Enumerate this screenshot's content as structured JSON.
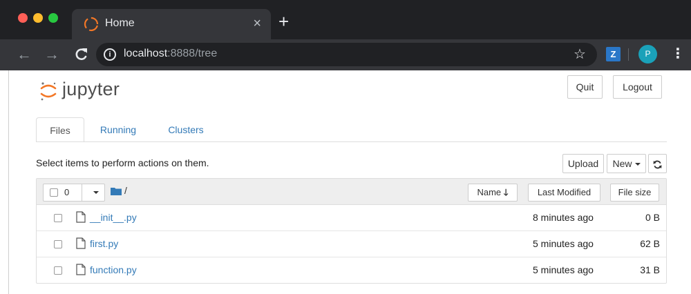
{
  "browser": {
    "tab_title": "Home",
    "tab_close": "×",
    "new_tab": "+",
    "url_host": "localhost",
    "url_rest": ":8888/tree",
    "profile_initial": "P",
    "extension_label": "Z"
  },
  "header": {
    "logo_text": "jupyter",
    "quit_label": "Quit",
    "logout_label": "Logout"
  },
  "tabs": [
    {
      "label": "Files",
      "active": true
    },
    {
      "label": "Running",
      "active": false
    },
    {
      "label": "Clusters",
      "active": false
    }
  ],
  "actions": {
    "select_message": "Select items to perform actions on them.",
    "upload_label": "Upload",
    "new_label": "New"
  },
  "file_list": {
    "selected_count": "0",
    "path": "/",
    "columns": {
      "name": "Name",
      "last_modified": "Last Modified",
      "file_size": "File size"
    },
    "rows": [
      {
        "name": "__init__.py",
        "modified": "8 minutes ago",
        "size": "0 B"
      },
      {
        "name": "first.py",
        "modified": "5 minutes ago",
        "size": "62 B"
      },
      {
        "name": "function.py",
        "modified": "5 minutes ago",
        "size": "31 B"
      }
    ]
  },
  "colors": {
    "link": "#337ab7",
    "jupyter_orange": "#f37726",
    "chrome_dark": "#202124",
    "chrome_toolbar": "#35363a"
  }
}
